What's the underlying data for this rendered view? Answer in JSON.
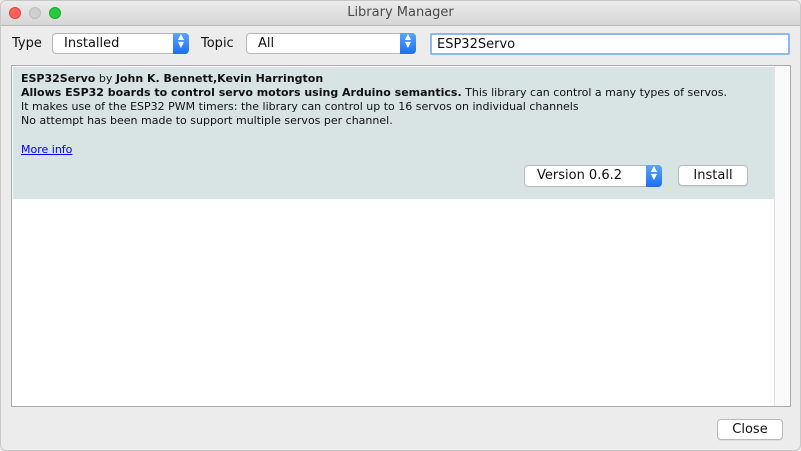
{
  "window": {
    "title": "Library Manager"
  },
  "filters": {
    "type_label": "Type",
    "type_value": "Installed",
    "topic_label": "Topic",
    "topic_value": "All",
    "search_value": "ESP32Servo"
  },
  "library": {
    "name": "ESP32Servo",
    "by": "by",
    "authors": "John K. Bennett,Kevin Harrington",
    "summary": "Allows ESP32 boards to control servo motors using Arduino semantics.",
    "desc1": "This library can control a many types of servos.",
    "desc2": "It makes use of the ESP32 PWM timers: the library can control up to 16 servos on individual channels",
    "desc3": "No attempt has been made to support multiple servos per channel.",
    "more_info": "More info",
    "version_label": "Version 0.6.2",
    "install_label": "Install"
  },
  "footer": {
    "close_label": "Close"
  },
  "colors": {
    "row_bg": "#d8e3e4",
    "accent": "#1c6ff2",
    "link": "#0000ee"
  },
  "icons": [
    "close-traffic-icon",
    "minimize-traffic-icon",
    "zoom-traffic-icon",
    "select-arrows-icon"
  ]
}
